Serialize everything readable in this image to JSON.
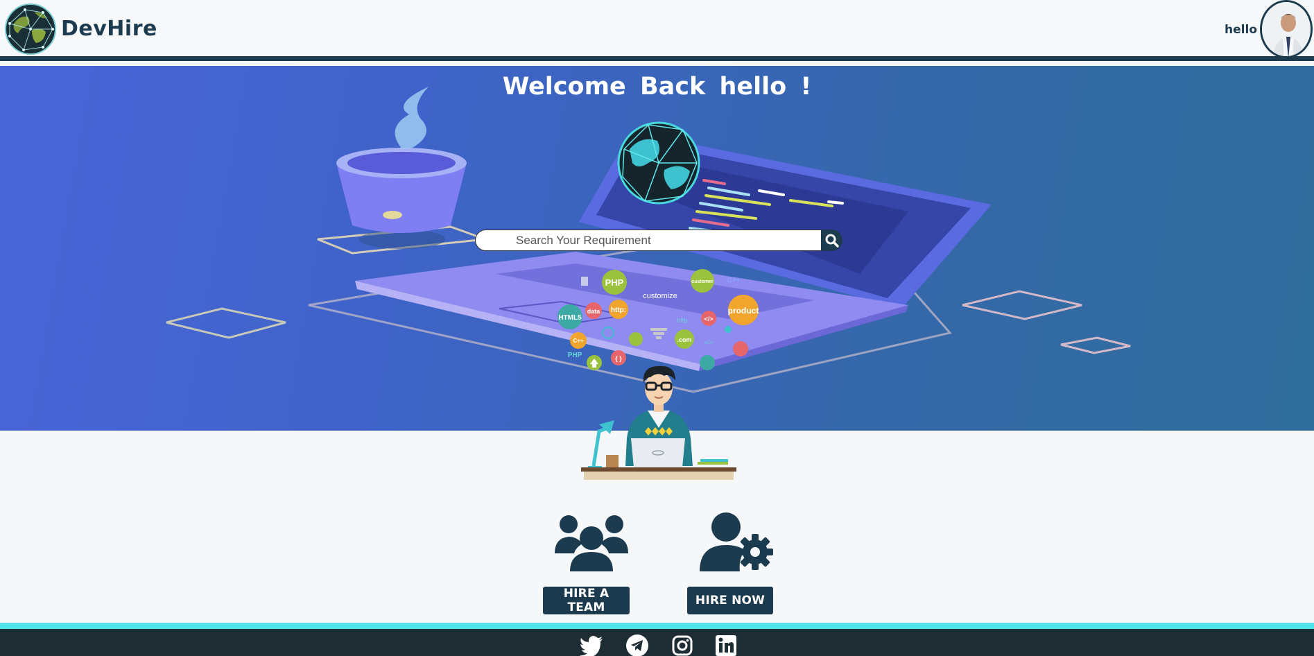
{
  "app": {
    "brand": "DevHire"
  },
  "header": {
    "user_name": "hello"
  },
  "hero": {
    "greeting": "Welcome Back hello !",
    "search": {
      "placeholder": "Search Your Requirement"
    },
    "bubbles": [
      "PHP",
      "customer",
      "C++",
      "customize",
      "product",
      "data",
      "http:",
      "HTML5",
      ".com",
      "</>",
      "{ }",
      "C++",
      "PHP",
      "http:"
    ]
  },
  "actions": {
    "hire_team_label": "HIRE A TEAM",
    "hire_now_label": "HIRE NOW"
  },
  "footer": {
    "social_icons": [
      "twitter-icon",
      "telegram-icon",
      "instagram-icon",
      "linkedin-icon"
    ]
  },
  "colors": {
    "primary": "#1d3b4e",
    "accent": "#4de3e8",
    "hero_start": "#4a65d8",
    "hero_end": "#2f6e9c",
    "footer": "#1e2c34"
  }
}
